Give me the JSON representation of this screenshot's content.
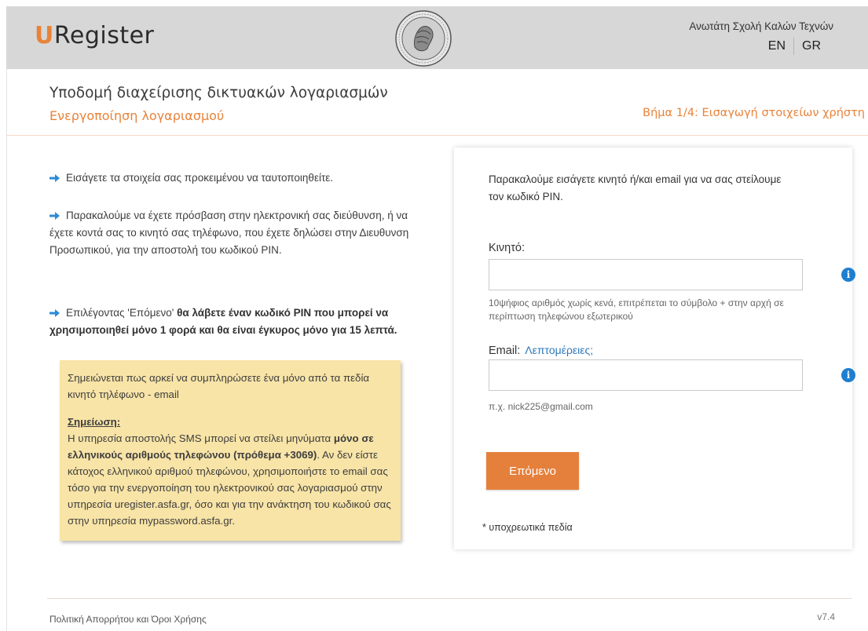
{
  "header": {
    "logo_u": "U",
    "logo_rest": "Register",
    "org_name": "Ανωτάτη Σχολή Καλών Τεχνών",
    "lang_en": "EN",
    "lang_gr": "GR",
    "accent_color": "#e8833a"
  },
  "page": {
    "title": "Υποδομή διαχείρισης δικτυακών λογαριασμών",
    "subtitle": "Ενεργοποίηση λογαριασμού",
    "step": "Βήμα 1/4: Εισαγωγή στοιχείων χρήστη"
  },
  "instructions": {
    "item1": "Εισάγετε τα στοιχεία σας προκειμένου να ταυτοποιηθείτε.",
    "item2": "Παρακαλούμε να έχετε πρόσβαση στην ηλεκτρονική σας διεύθυνση, ή να έχετε κοντά σας το κινητό σας τηλέφωνο, που έχετε δηλώσει στην Διευθυνση Προσωπικού, για την αποστολή του κωδικού PIN.",
    "item3_pre": "Επιλέγοντας 'Επόμενο' ",
    "item3_bold": "θα λάβετε έναν κωδικό PIN που μπορεί να χρησιμοποιηθεί μόνο 1 φορά και θα είναι έγκυρος μόνο για 15 λεπτά."
  },
  "note": {
    "intro": "Σημειώνεται πως αρκεί να συμπληρώσετε ένα μόνο από τα πεδία κινητό τηλέφωνο - email",
    "heading": "Σημείωση:",
    "text1": "Η υπηρεσία αποστολής SMS μπορεί να στείλει μηνύματα ",
    "bold1": "μόνο σε ελληνικούς αριθμούς τηλεφώνου (πρόθεμα +3069)",
    "text2": ". Αν δεν είστε κάτοχος ελληνικού αριθμού τηλεφώνου, χρησιμοποιήστε το email σας τόσο για την ενεργοποίηση του ηλεκτρονικού σας λογαριασμού στην υπηρεσία uregister.asfa.gr, όσο και για την ανάκτηση του κωδικού σας στην υπηρεσία mypassword.asfa.gr."
  },
  "form": {
    "intro": "Παρακαλούμε εισάγετε κινητό ή/και email για να σας στείλουμε τον κωδικό PIN.",
    "mobile_label": "Κινητό:",
    "mobile_value": "",
    "mobile_hint": "10ψήφιος αριθμός χωρίς κενά, επιτρέπεται το σύμβολο + στην αρχή σε περίπτωση τηλεφώνου εξωτερικού",
    "email_label": "Email:",
    "email_more": "Λεπτομέρειες;",
    "email_value": "",
    "email_hint": "π.χ. nick225@gmail.com",
    "info_glyph": "i",
    "next_label": "Επόμενο",
    "required_note": "* υποχρεωτικά πεδία"
  },
  "footer": {
    "policy": "Πολιτική Απορρήτου και Όροι Χρήσης",
    "version": "v7.4"
  }
}
